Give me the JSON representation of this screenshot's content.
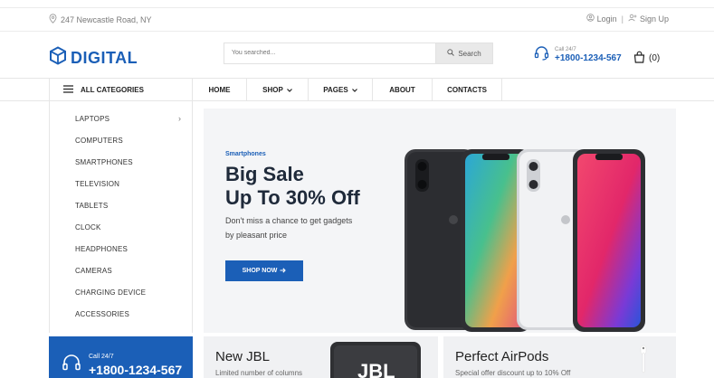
{
  "topbar": {
    "address": "247 Newcastle Road, NY",
    "login": "Login",
    "separator": "|",
    "signup": "Sign Up"
  },
  "header": {
    "logo_text": "DIGITAL",
    "search_placeholder": "You searched...",
    "search_button": "Search",
    "call_label": "Call 24/7",
    "call_number": "+1800-1234-567",
    "cart_count": "(0)"
  },
  "nav": {
    "all_categories": "ALL CATEGORIES",
    "items": [
      {
        "label": "HOME"
      },
      {
        "label": "SHOP"
      },
      {
        "label": "PAGES"
      },
      {
        "label": "ABOUT"
      },
      {
        "label": "CONTACTS"
      }
    ]
  },
  "sidebar": {
    "items": [
      {
        "label": "LAPTOPS"
      },
      {
        "label": "COMPUTERS"
      },
      {
        "label": "SMARTPHONES"
      },
      {
        "label": "TELEVISION"
      },
      {
        "label": "TABLETS"
      },
      {
        "label": "CLOCK"
      },
      {
        "label": "HEADPHONES"
      },
      {
        "label": "CAMERAS"
      },
      {
        "label": "CHARGING DEVICE"
      },
      {
        "label": "ACCESSORIES"
      }
    ]
  },
  "hero": {
    "kicker": "Smartphones",
    "title_line1": "Big Sale",
    "title_line2": "Up To 30% Off",
    "desc_line1": "Don't miss a chance to get gadgets",
    "desc_line2": "by pleasant price",
    "button": "SHOP NOW"
  },
  "callbox": {
    "label": "Call 24/7",
    "number": "+1800-1234-567"
  },
  "cards": [
    {
      "title": "New JBL",
      "subtitle": "Limited number of columns",
      "badge": "JBL"
    },
    {
      "title": "Perfect AirPods",
      "subtitle": "Special offer discount up to 10% Off"
    }
  ],
  "colors": {
    "brand": "#1b5fb7",
    "hero_bg": "#f4f5f7",
    "card_bg": "#f0f1f3"
  }
}
